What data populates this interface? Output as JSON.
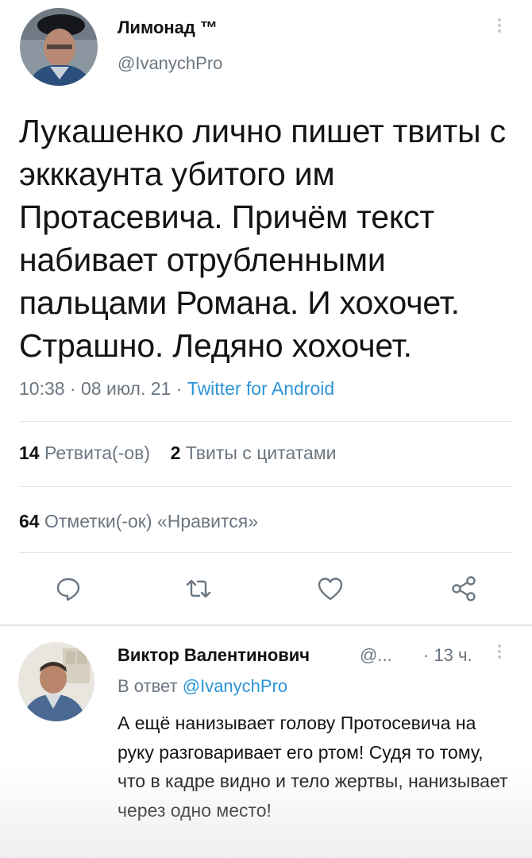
{
  "tweet": {
    "author_name": "Лимонад ™",
    "author_handle": "@IvanychPro",
    "text": "Лукашенко лично пишет твиты с экккаунта убитого им Протасевича. Причём текст набивает отрубленными пальцами Романа. И хохочет. Страшно. Ледяно хохочет.",
    "meta_datetime": "10:38 · 08 июл. 21 · ",
    "meta_source": "Twitter for Android",
    "retweets_count": "14",
    "retweets_label": "Ретвита(-ов)",
    "quotes_count": "2",
    "quotes_label": "Твиты с цитатами",
    "likes_count": "64",
    "likes_label": "Отметки(-ок) «Нравится»"
  },
  "reply": {
    "author_name": "Виктор Валентинович",
    "author_handle": "@...",
    "time": "· 13 ч.",
    "reply_to_prefix": "В ответ ",
    "reply_to_handle": "@IvanychPro",
    "text": "А ещё нанизывает голову Протосевича на руку разговаривает его ртом! Судя то тому, что в кадре видно и тело жертвы, нанизывает через одно место!"
  },
  "icons": {
    "reply": "speech-bubble-icon",
    "retweet": "retweet-icon",
    "like": "heart-icon",
    "share": "share-icon",
    "more": "more-vertical-icon"
  },
  "colors": {
    "link": "#2d95d8",
    "secondary_text": "#6b7680",
    "divider": "#e3e6e9"
  }
}
